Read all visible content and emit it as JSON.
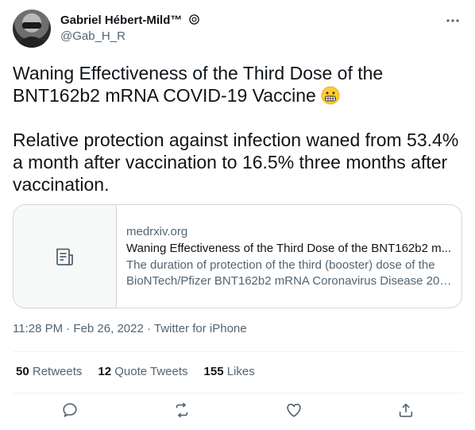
{
  "author": {
    "display_name": "Gabriel Hébert-Mild™",
    "handle": "@Gab_H_R"
  },
  "tweet": {
    "paragraph1": "Waning Effectiveness of the Third Dose of the BNT162b2 mRNA COVID-19 Vaccine",
    "paragraph2": "Relative protection against infection waned from 53.4% a month after vaccination to 16.5% three months after vaccination."
  },
  "card": {
    "domain": "medrxiv.org",
    "title": "Waning Effectiveness of the Third Dose of the BNT162b2 m...",
    "desc_line1": "The duration of protection of the third (booster) dose of the",
    "desc_line2": "BioNTech/Pfizer BNT162b2 mRNA Coronavirus Disease 2019..."
  },
  "meta": "11:28 PM · Feb 26, 2022 · Twitter for iPhone",
  "stats": {
    "retweets_count": "50",
    "retweets_label": "Retweets",
    "quotes_count": "12",
    "quotes_label": "Quote Tweets",
    "likes_count": "155",
    "likes_label": "Likes"
  },
  "icons": {
    "verified": "verified-badge-icon",
    "more": "more-dots-icon",
    "emoji": "grimacing-face-emoji",
    "card_thumb": "document-icon",
    "reply": "reply-icon",
    "retweet": "retweet-icon",
    "like": "heart-icon",
    "share": "share-icon"
  },
  "colors": {
    "text_primary": "#0f1419",
    "text_secondary": "#536471",
    "border": "#cfd9de",
    "divider": "#eff3f4"
  }
}
